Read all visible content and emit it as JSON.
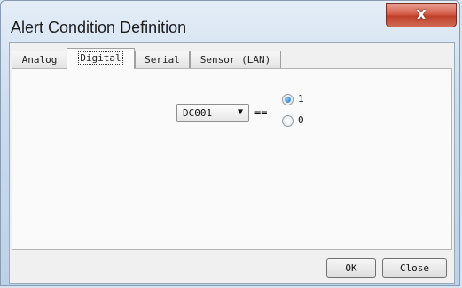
{
  "window": {
    "title": "Alert Condition Definition",
    "close_glyph": "X"
  },
  "tabs": [
    {
      "label": "Analog",
      "active": false
    },
    {
      "label": "Digital",
      "active": true
    },
    {
      "label": "Serial",
      "active": false
    },
    {
      "label": "Sensor (LAN)",
      "active": false
    }
  ],
  "condition": {
    "channel_selected": "DC001",
    "operator": "==",
    "options": [
      {
        "label": "1",
        "checked": true
      },
      {
        "label": "0",
        "checked": false
      }
    ]
  },
  "buttons": {
    "ok": "OK",
    "close": "Close"
  }
}
